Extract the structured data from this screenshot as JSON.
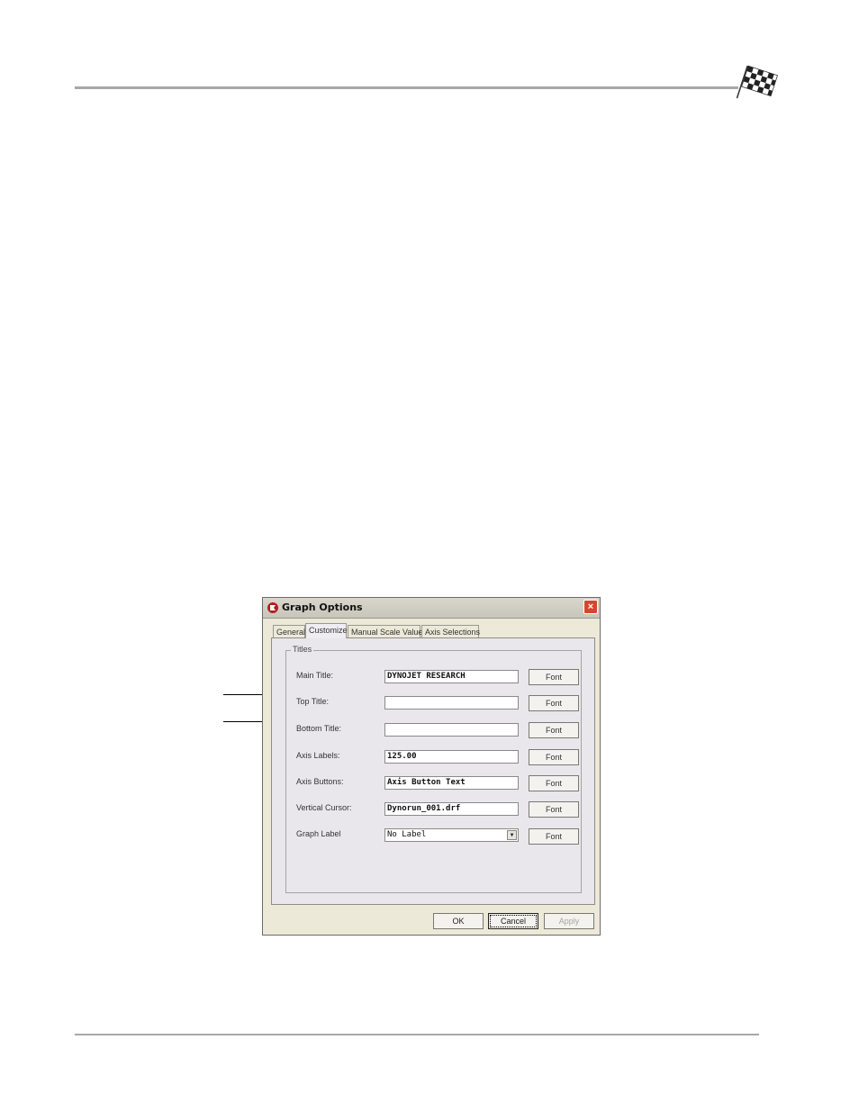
{
  "dialog": {
    "title": "Graph Options",
    "close_label": "×",
    "tabs": [
      {
        "label": "General"
      },
      {
        "label": "Customize"
      },
      {
        "label": "Manual Scale Values"
      },
      {
        "label": "Axis Selections"
      }
    ],
    "active_tab": "Customize",
    "groupbox_label": "Titles",
    "rows": [
      {
        "label": "Main Title:",
        "value": "DYNOJET RESEARCH",
        "button": "Font"
      },
      {
        "label": "Top Title:",
        "value": "",
        "button": "Font"
      },
      {
        "label": "Bottom Title:",
        "value": "",
        "button": "Font"
      },
      {
        "label": "Axis Labels:",
        "value": "125.00",
        "button": "Font"
      },
      {
        "label": "Axis Buttons:",
        "value": "Axis Button Text",
        "button": "Font"
      },
      {
        "label": "Vertical Cursor:",
        "value": "Dynorun_001.drf",
        "button": "Font"
      },
      {
        "label": "Graph Label",
        "value": "No Label",
        "button": "Font"
      }
    ],
    "buttons": {
      "ok": "OK",
      "cancel": "Cancel",
      "apply": "Apply"
    }
  },
  "colors": {
    "close_button": "#d8452f",
    "rule": "#a8a8a8"
  },
  "icons": {
    "header_logo": "checkered-flag-icon",
    "dialog_icon": "app-logo-icon",
    "dropdown": "chevron-down-icon"
  }
}
